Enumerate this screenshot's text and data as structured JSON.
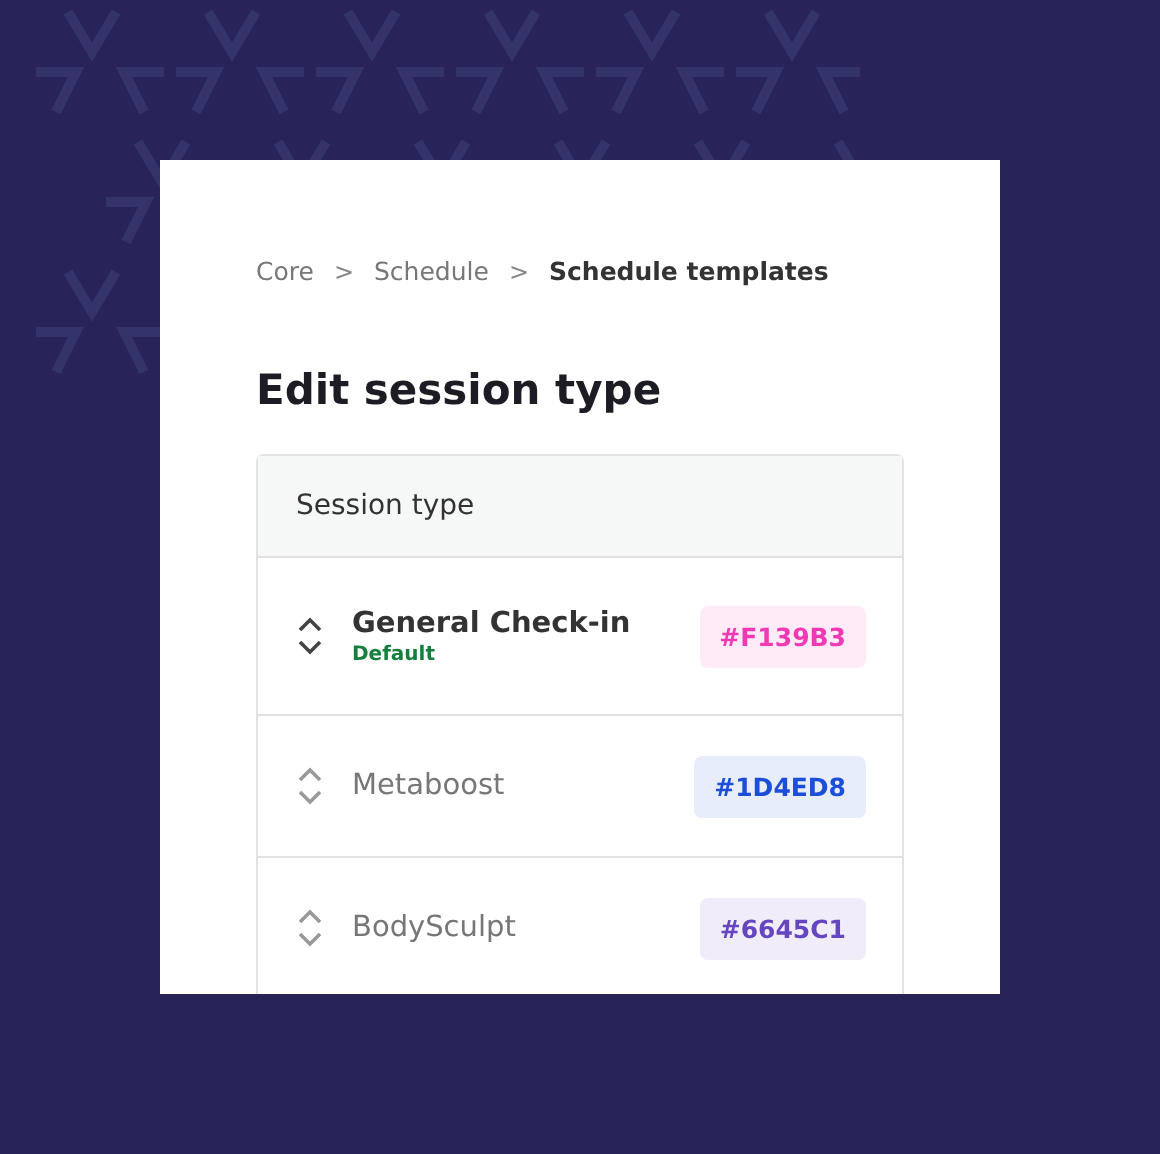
{
  "breadcrumb": [
    {
      "label": "Core",
      "current": false
    },
    {
      "label": "Schedule",
      "current": false
    },
    {
      "label": "Schedule templates",
      "current": true
    }
  ],
  "breadcrumb_separator": ">",
  "title": "Edit session type",
  "table": {
    "columns": [
      "Session type"
    ],
    "rows": [
      {
        "name": "General Check-in",
        "default": true,
        "default_label": "Default",
        "code": "#F139B3",
        "color": "#f139b3"
      },
      {
        "name": "Metaboost",
        "default": false,
        "code": "#1D4ED8",
        "color": "#1d4ed8"
      },
      {
        "name": "BodySculpt",
        "default": false,
        "code": "#6645C1",
        "color": "#6645c1"
      }
    ]
  }
}
